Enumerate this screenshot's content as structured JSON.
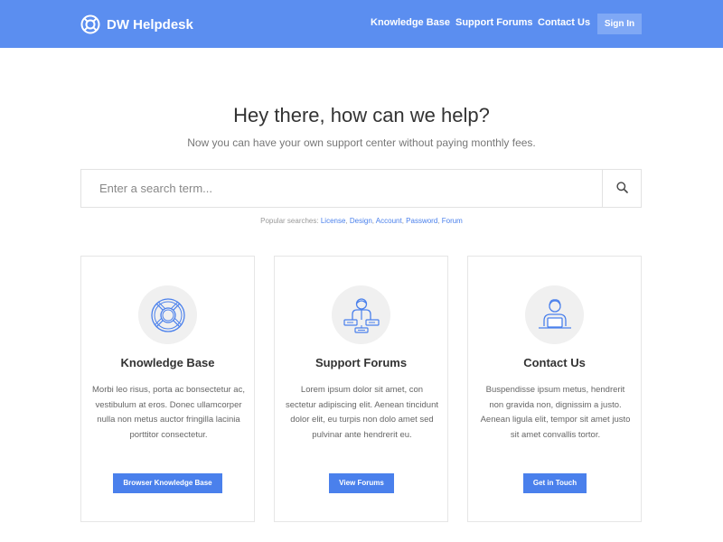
{
  "brand": {
    "name": "DW Helpdesk",
    "icon": "lifebuoy-icon"
  },
  "nav": {
    "links": [
      "Knowledge Base",
      "Support Forums",
      "Contact Us"
    ],
    "signin": "Sign In"
  },
  "hero": {
    "title": "Hey there, how can we help?",
    "subtitle": "Now you can have your own support center without paying monthly fees."
  },
  "search": {
    "placeholder": "Enter a search term...",
    "value": "",
    "icon": "search-icon"
  },
  "popular": {
    "label": "Popular searches:",
    "terms": [
      "License",
      "Design",
      "Account",
      "Password",
      "Forum"
    ]
  },
  "cards": [
    {
      "icon": "lifebuoy-icon",
      "title": "Knowledge Base",
      "text": "Morbi leo risus, porta ac bonsectetur ac, vestibulum at eros. Donec ullamcorper nulla non metus auctor fringilla lacinia porttitor consectetur.",
      "button": "Browser Knowledge Base"
    },
    {
      "icon": "forum-user-icon",
      "title": "Support Forums",
      "text": "Lorem ipsum dolor sit amet, con sectetur adipiscing elit. Aenean tincidunt dolor elit, eu turpis non dolo amet sed pulvinar ante hendrerit eu.",
      "button": "View Forums"
    },
    {
      "icon": "support-agent-icon",
      "title": "Contact Us",
      "text": "Buspendisse ipsum metus, hendrerit non gravida non, dignissim a justo. Aenean ligula elit, tempor sit amet justo sit amet convallis tortor.",
      "button": "Get in Touch"
    }
  ],
  "colors": {
    "navbar": "#5b8ef0",
    "accent": "#4a80ec",
    "signin_bg": "#7fa8f5",
    "icon_stroke": "#4a80ec"
  }
}
